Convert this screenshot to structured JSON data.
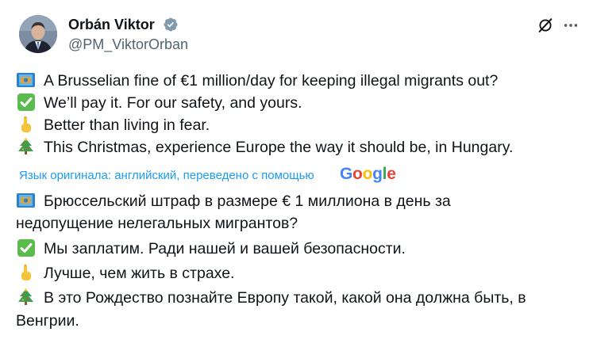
{
  "author": {
    "display_name": "Orbán Viktor",
    "handle": "@PM_ViktorOrban",
    "verified": true
  },
  "actions": {
    "grok_icon": "grok-icon",
    "more_icon": "more-icon"
  },
  "original_lines": [
    {
      "emoji": "money-banknote-icon",
      "text": "A Brusselian fine of €1 million/day for keeping illegal migrants out?"
    },
    {
      "emoji": "check-mark-icon",
      "text": "We’ll pay it. For our safety, and yours."
    },
    {
      "emoji": "pointing-up-icon",
      "text": "Better than living in fear."
    },
    {
      "emoji": "christmas-tree-icon",
      "text": "This Christmas, experience Europe the way it should be, in Hungary."
    }
  ],
  "translation": {
    "note": "Язык оригинала: английский, переведено с помощью",
    "provider": "Google"
  },
  "translated_lines": [
    {
      "emoji": "money-banknote-icon",
      "text": "Брюссельский штраф в размере € 1 миллиона в день за"
    },
    {
      "emoji": "",
      "text": "недопущение нелегальных мигрантов?"
    },
    {
      "emoji": "check-mark-icon",
      "text": "Мы заплатим. Ради нашей и вашей безопасности."
    },
    {
      "emoji": "pointing-up-icon",
      "text": "Лучше, чем жить в страхе."
    },
    {
      "emoji": "christmas-tree-icon",
      "text": "В это Рождество познайте Европу такой, какой она должна быть, в"
    },
    {
      "emoji": "",
      "text": "Венгрии."
    }
  ],
  "colors": {
    "text": "#0f1419",
    "secondary": "#536471",
    "link": "#1d9bf0",
    "verified_badge": "#829aab"
  }
}
